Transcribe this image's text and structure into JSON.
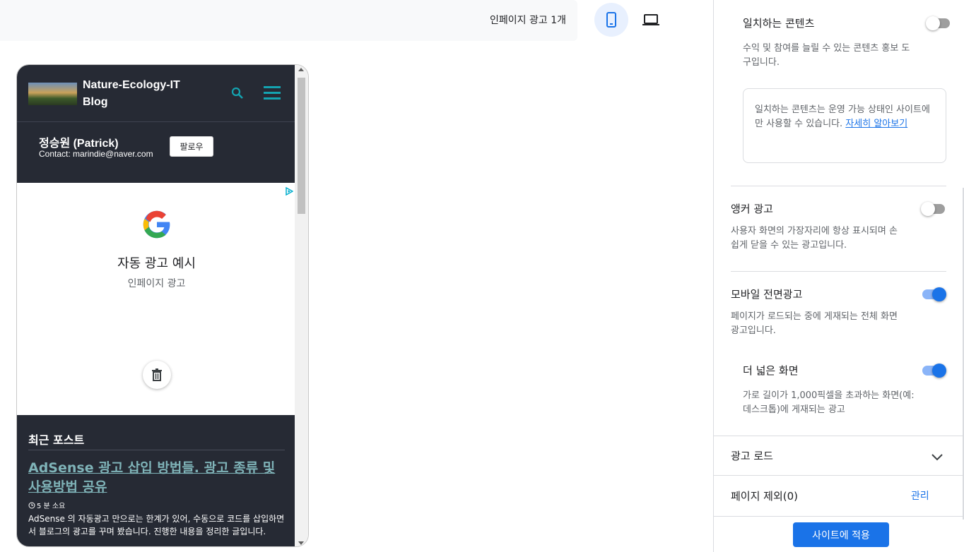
{
  "topbar": {
    "ad_count": "인페이지 광고 1개",
    "mobile_icon": "smartphone-icon",
    "desktop_icon": "laptop-icon"
  },
  "preview": {
    "blog": {
      "title": "Nature-Ecology-IT Blog",
      "search_icon": "search-icon",
      "menu_icon": "hamburger-menu-icon"
    },
    "profile": {
      "name": "정승원 (Patrick)",
      "contact": "Contact: marindie@naver.com",
      "follow_label": "팔로우"
    },
    "ad": {
      "title": "자동 광고 예시",
      "subtitle": "인페이지 광고",
      "logo_icon": "google-g-icon",
      "delete_icon": "trash-icon",
      "adchoices_icon": "adchoices-icon"
    },
    "recent": {
      "heading": "최근 포스트",
      "post_title": "AdSense 광고 삽입 방법들. 광고 종류 및 사용방법 공유",
      "read_time": "5 분 소요",
      "excerpt": "AdSense 의 자동광고 만으로는 한계가 있어, 수동으로 코드를 삽입하면서 블로그의 광고를 꾸며 봤습니다. 진행한 내용을 정리한 글입니다."
    }
  },
  "settings": {
    "matched_content": {
      "title": "일치하는 콘텐츠",
      "desc": "수익 및 참여를 늘릴 수 있는 콘텐츠 홍보 도구입니다.",
      "enabled": false,
      "info": "일치하는 콘텐츠는 운영 가능 상태인 사이트에만 사용할 수 있습니다.",
      "info_link": "자세히 알아보기"
    },
    "anchor": {
      "title": "앵커 광고",
      "desc": "사용자 화면의 가장자리에 항상 표시되며 손쉽게 닫을 수 있는 광고입니다.",
      "enabled": false
    },
    "vignette": {
      "title": "모바일 전면광고",
      "desc": "페이지가 로드되는 중에 게재되는 전체 화면 광고입니다.",
      "enabled": true
    },
    "wider": {
      "title": "더 넓은 화면",
      "desc": "가로 길이가 1,000픽셀을 초과하는 화면(예: 데스크톱)에 게재되는 광고",
      "enabled": true
    },
    "ad_load": {
      "title": "광고 로드",
      "icon": "chevron-down-icon"
    },
    "exclusions": {
      "title": "페이지 제외(0)",
      "manage_label": "관리"
    },
    "apply_label": "사이트에 적용"
  },
  "colors": {
    "accent": "#1a73e8",
    "blog_bg": "#262a34",
    "blog_accent": "#14a3b0"
  }
}
